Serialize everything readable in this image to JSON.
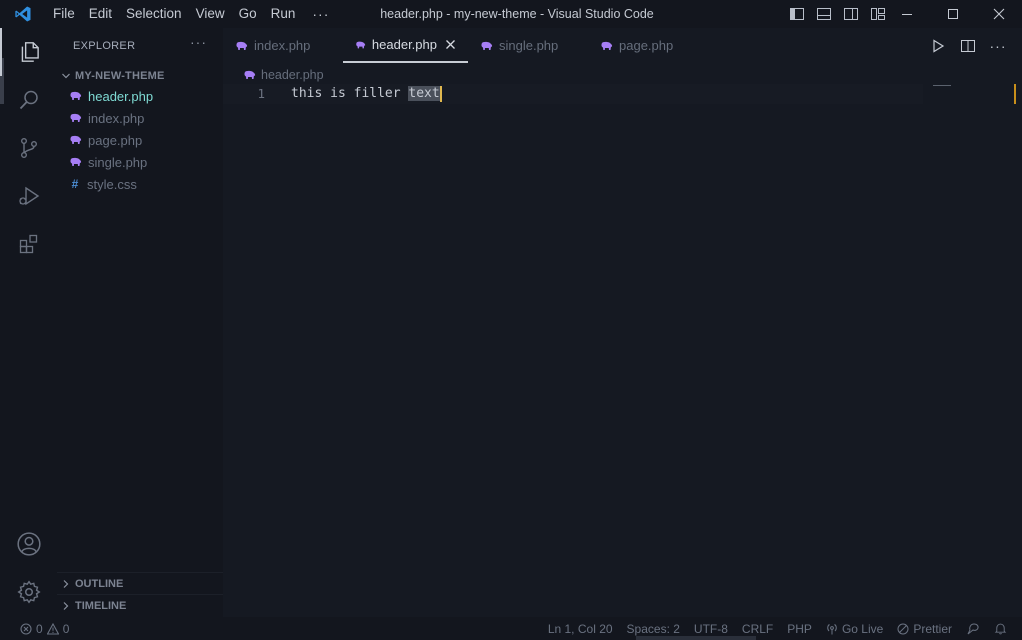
{
  "titlebar": {
    "menu": [
      "File",
      "Edit",
      "Selection",
      "View",
      "Go",
      "Run"
    ],
    "more": "···",
    "window_title": "header.php - my-new-theme - Visual Studio Code"
  },
  "activitybar": {
    "items": [
      "explorer-icon",
      "search-icon",
      "source-control-icon",
      "run-debug-icon",
      "extensions-icon",
      "accounts-icon",
      "settings-gear-icon"
    ]
  },
  "sidebar": {
    "title": "EXPLORER",
    "more": "···",
    "folder": "MY-NEW-THEME",
    "files": [
      {
        "name": "header.php",
        "icon": "php-elephant-icon"
      },
      {
        "name": "index.php",
        "icon": "php-elephant-icon"
      },
      {
        "name": "page.php",
        "icon": "php-elephant-icon"
      },
      {
        "name": "single.php",
        "icon": "php-elephant-icon"
      },
      {
        "name": "style.css",
        "icon": "hash-icon",
        "glyph": "#"
      }
    ],
    "outline": "OUTLINE",
    "timeline": "TIMELINE"
  },
  "editor": {
    "tabs": [
      {
        "name": "index.php",
        "active": false
      },
      {
        "name": "header.php",
        "active": true
      },
      {
        "name": "single.php",
        "active": false
      },
      {
        "name": "page.php",
        "active": false
      }
    ],
    "breadcrumb": "header.php",
    "line_number": "1",
    "code_before_selection": "this is filler ",
    "code_selection": "text"
  },
  "statusbar": {
    "errors": "0",
    "warnings": "0",
    "position": "Ln 1, Col 20",
    "spaces": "Spaces: 2",
    "encoding": "UTF-8",
    "eol": "CRLF",
    "language": "PHP",
    "go_live": "Go Live",
    "prettier": "Prettier"
  },
  "colors": {
    "background": "#13161e",
    "editor_bg": "#151922",
    "php_icon": "#a67ef5",
    "selected_file": "#7fdbd4",
    "vscode_blue": "#2f8fe0",
    "cursor": "#e0b84f"
  }
}
